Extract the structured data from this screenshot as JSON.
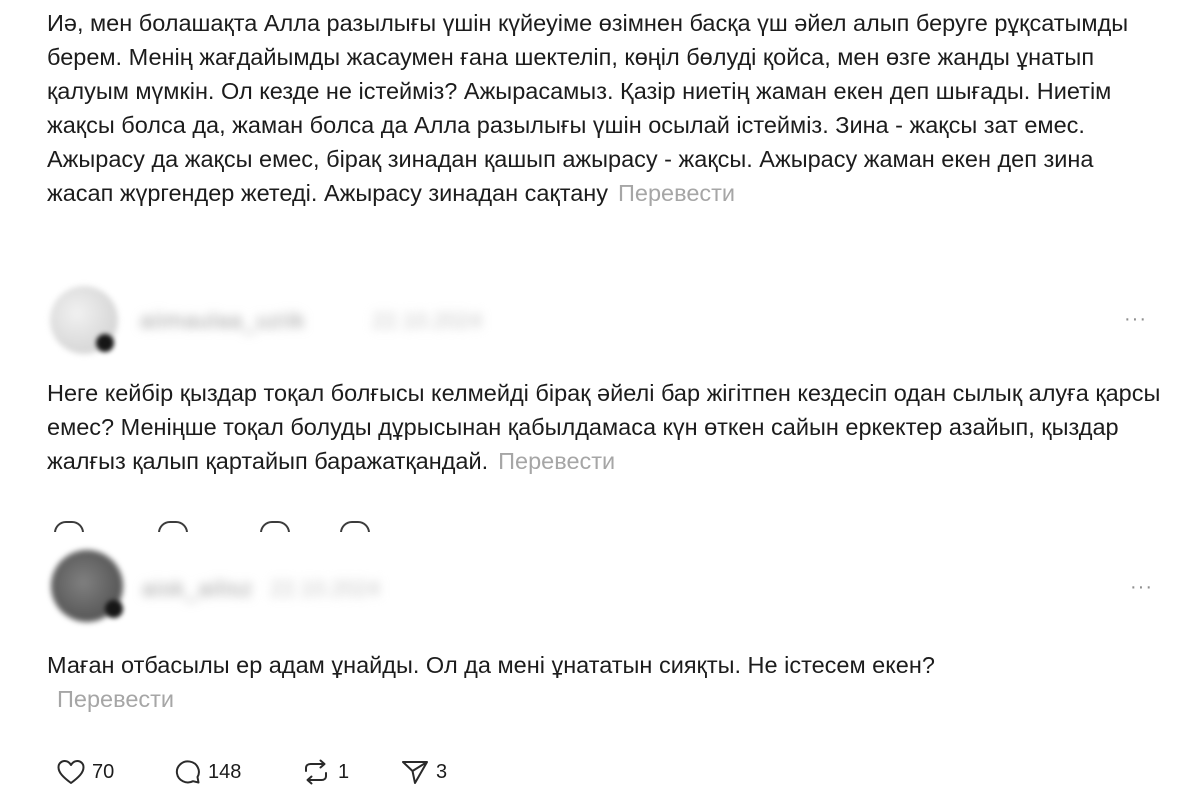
{
  "posts": [
    {
      "text": "Иә, мен болашақта Алла разылығы үшін күйеуіме өзімнен басқа үш әйел алып беруге рұқсатымды берем. Менің жағдайымды жасаумен ғана шектеліп, көңіл бөлуді қойса, мен өзге жанды ұнатып қалуым мүмкін. Ол кезде не істейміз? Ажырасамыз. Қазір ниетің жаман екен деп шығады. Ниетім жақсы болса да, жаман болса да Алла разылығы үшін осылай істейміз. Зина - жақсы зат емес. Ажырасу да жақсы емес, бірақ зинадан қашып ажырасу - жақсы. Ажырасу жаман екен деп зина жасап жүргендер жетеді. Ажырасу зинадан сақтану",
      "translate_label": "Перевести"
    },
    {
      "username": "aiimaulaa_uziik",
      "timestamp": "22.10.2024",
      "text": "Неге кейбір қыздар тоқал болғысы келмейді бірақ әйелі бар жігітпен кездесіп одан сылық алуға қарсы емес? Меніңше тоқал болуды дұрысынан қабылдамаса күн өткен сайын еркектер азайып, қыздар жалғыз қалып қартайып баражатқандай.",
      "translate_label": "Перевести",
      "more_label": "···"
    },
    {
      "username": "aisk_ailisz",
      "timestamp": "22.10.2024",
      "text": "Маған отбасылы ер адам ұнайды. Ол да мені ұнататын сияқты. Не істесем екен?",
      "translate_label": "Перевести",
      "more_label": "···",
      "actions": {
        "likes": "70",
        "replies": "148",
        "reposts": "1",
        "shares": "3"
      }
    }
  ],
  "icons": {
    "like": "heart-icon",
    "reply": "speech-bubble-icon",
    "repost": "repost-arrows-icon",
    "share": "send-paper-plane-icon",
    "more": "more-horizontal-icon"
  },
  "colors": {
    "text": "#1c1c1c",
    "muted": "#a6a6a6",
    "background": "#ffffff"
  }
}
